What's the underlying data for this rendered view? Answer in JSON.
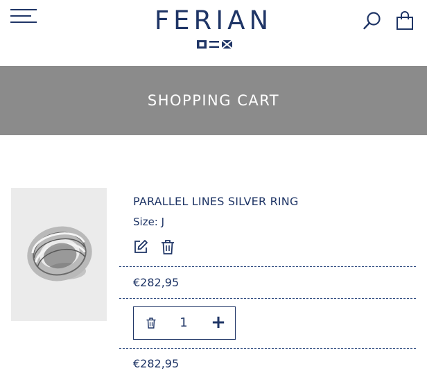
{
  "header": {
    "logo_text": "FERIAN",
    "menu_icon": "hamburger-menu-icon",
    "search_icon": "search-icon",
    "cart_icon": "shopping-bag-icon",
    "brand_color": "#1f3566"
  },
  "banner": {
    "title": "SHOPPING CART",
    "background": "#8b8b8b"
  },
  "cart": {
    "items": [
      {
        "name": "PARALLEL LINES SILVER RING",
        "size_label": "Size: J",
        "unit_price": "€282,95",
        "quantity": "1",
        "line_total": "€282,95",
        "edit_icon": "edit-icon",
        "delete_icon": "trash-icon",
        "increase_icon": "plus-icon"
      }
    ]
  }
}
